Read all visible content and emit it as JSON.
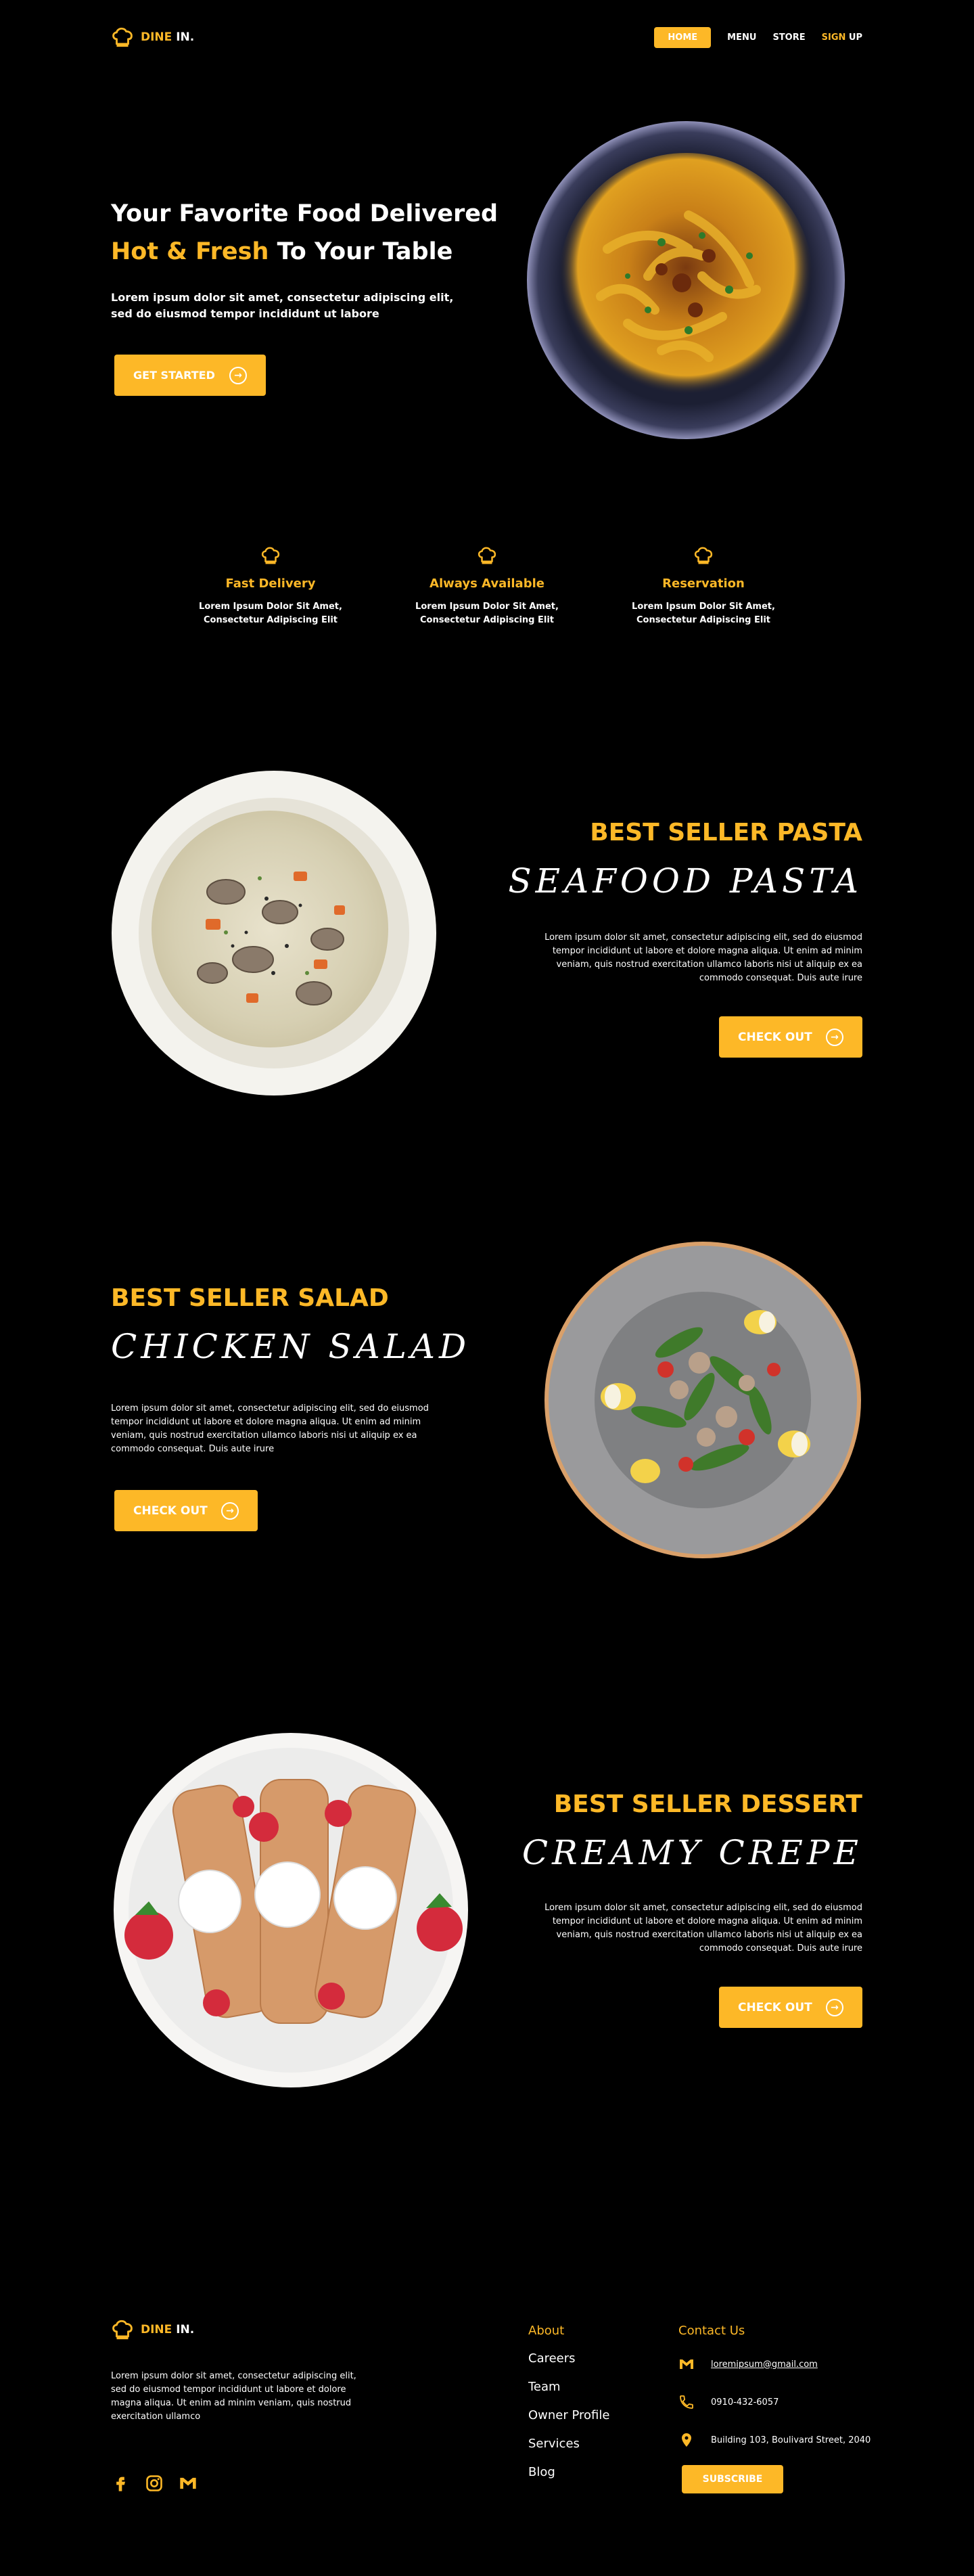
{
  "brand": {
    "name_part1": "DINE",
    "name_part2": " IN."
  },
  "nav": {
    "home": "HOME",
    "menu": "MENU",
    "store": "STORE",
    "sign": "SIGN",
    "up": " UP"
  },
  "hero": {
    "title_line1": "Your Favorite Food Delivered",
    "title_highlight": "Hot & Fresh",
    "title_rest": " To Your Table",
    "text": "Lorem ipsum dolor sit amet, consectetur adipiscing elit, sed do eiusmod tempor incididunt ut labore",
    "button": "GET STARTED"
  },
  "features": [
    {
      "title": "Fast Delivery",
      "desc": "Lorem Ipsum Dolor Sit Amet, Consectetur Adipiscing Elit"
    },
    {
      "title": "Always Available",
      "desc": "Lorem Ipsum Dolor Sit Amet, Consectetur Adipiscing Elit"
    },
    {
      "title": "Reservation",
      "desc": "Lorem Ipsum Dolor Sit Amet, Consectetur Adipiscing Elit"
    }
  ],
  "sections": [
    {
      "title": "BEST SELLER PASTA",
      "name": "SEAFOOD PASTA",
      "text": "Lorem ipsum dolor sit amet, consectetur adipiscing elit, sed do eiusmod tempor incididunt ut labore et dolore magna aliqua. Ut enim ad minim veniam, quis nostrud exercitation ullamco laboris nisi ut aliquip ex ea commodo consequat. Duis aute irure",
      "button": "CHECK OUT"
    },
    {
      "title": "BEST SELLER SALAD",
      "name": "CHICKEN SALAD",
      "text": "Lorem ipsum dolor sit amet, consectetur adipiscing elit, sed do eiusmod tempor incididunt ut labore et dolore magna aliqua. Ut enim ad minim veniam, quis nostrud exercitation ullamco laboris nisi ut aliquip ex ea commodo consequat. Duis aute irure",
      "button": "CHECK OUT"
    },
    {
      "title": "BEST SELLER DESSERT",
      "name": "CREAMY CREPE",
      "text": "Lorem ipsum dolor sit amet, consectetur adipiscing elit, sed do eiusmod tempor incididunt ut labore et dolore magna aliqua. Ut enim ad minim veniam, quis nostrud exercitation ullamco laboris nisi ut aliquip ex ea commodo consequat. Duis aute irure",
      "button": "CHECK OUT"
    }
  ],
  "footer": {
    "text": "Lorem ipsum dolor sit amet, consectetur adipiscing elit, sed do eiusmod tempor incididunt ut labore et dolore magna aliqua. Ut enim ad minim veniam, quis nostrud exercitation ullamco",
    "about_heading": "About",
    "about_links": [
      "Careers",
      "Team",
      "Owner Profile",
      "Services",
      "Blog"
    ],
    "contact_heading": "Contact Us",
    "email": "loremipsum@gmail.com",
    "phone": "0910-432-6057",
    "address": "Building 103, Boulivard Street, 2040",
    "subscribe": "SUBSCRIBE"
  },
  "colors": {
    "accent": "#FDB827",
    "background": "#000000"
  }
}
